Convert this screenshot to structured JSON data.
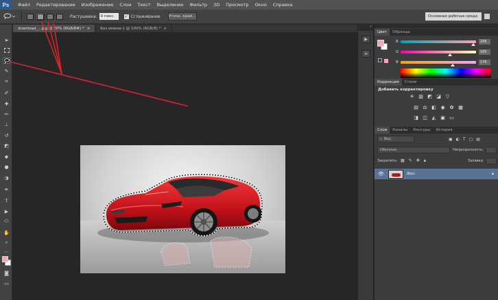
{
  "app": {
    "logo": "Ps"
  },
  "menu": [
    "Файл",
    "Редактирование",
    "Изображение",
    "Слои",
    "Текст",
    "Выделение",
    "Фильтр",
    "3D",
    "Просмотр",
    "Окно",
    "Справка"
  ],
  "options_bar": {
    "feather_label": "Растушевка:",
    "feather_value": "0 пикс.",
    "antialias_label": "Сглаживание",
    "refine_edge_label": "Уточн. край...",
    "workspace_label": "Основная рабочая среда"
  },
  "documents": {
    "tabs": [
      {
        "label": "download_...jpg @ 20% (RGB/8#) *",
        "active": true
      },
      {
        "label": "Без имени-1 @ 100% (RGB/8) *",
        "active": false
      }
    ]
  },
  "color_panel": {
    "tabs": [
      "Цвет",
      "Образцы"
    ],
    "channels": [
      {
        "name": "R",
        "value": "245",
        "level": 0.96
      },
      {
        "name": "G",
        "value": "165",
        "level": 0.65
      },
      {
        "name": "B",
        "value": "176",
        "level": 0.69
      }
    ],
    "foreground": "#f5a5b0",
    "background": "#ffffff"
  },
  "adjustments_panel": {
    "tabs": [
      "Коррекция",
      "Стили"
    ],
    "title": "Добавить корректировку"
  },
  "layers_panel": {
    "tabs": [
      "Слои",
      "Каналы",
      "Контуры",
      "История"
    ],
    "kind_label": "Вид",
    "blend_mode": "Обычные",
    "opacity_label": "Непрозрачность:",
    "lock_label": "Закрепить:",
    "fill_label": "Заливка:",
    "layers": [
      {
        "name": "Фон",
        "selected": true
      }
    ]
  },
  "colors": {
    "accent_red": "#d9232a",
    "selected_layer": "#5a7394"
  }
}
